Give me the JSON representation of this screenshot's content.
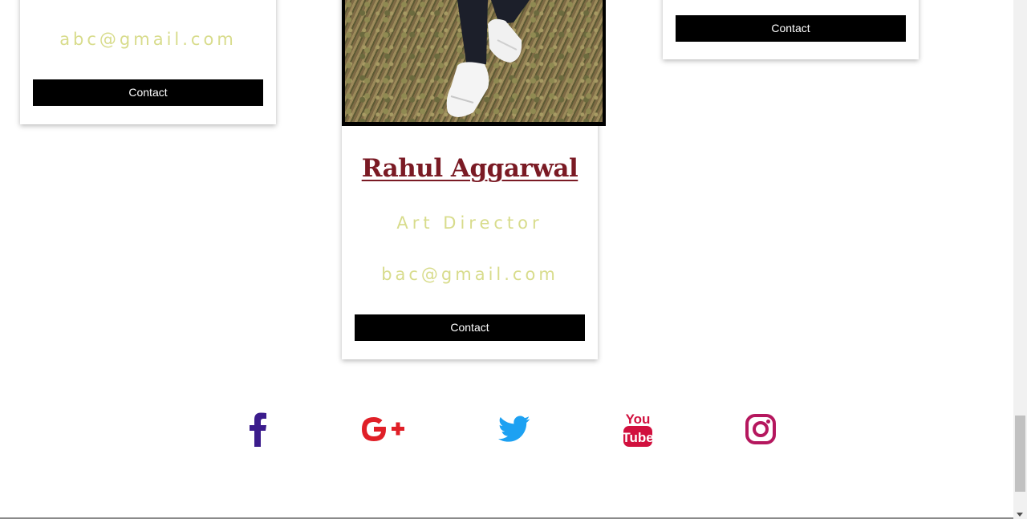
{
  "cards": [
    {
      "email": "abc@gmail.com",
      "contact_label": "Contact"
    },
    {
      "name": "Rahul Aggarwal",
      "role": "Art Director",
      "email": "bac@gmail.com",
      "contact_label": "Contact"
    },
    {
      "contact_label": "Contact"
    }
  ],
  "social": [
    {
      "icon": "facebook-icon",
      "color": "#3b1c8c"
    },
    {
      "icon": "google-plus-icon",
      "color": "#e01f27"
    },
    {
      "icon": "twitter-icon",
      "color": "#1da1f2"
    },
    {
      "icon": "youtube-icon",
      "color": "#d1103e"
    },
    {
      "icon": "instagram-icon",
      "color": "#b5175e"
    }
  ],
  "colors": {
    "accent_text": "#d8dc8c",
    "name_color": "#7a1a24",
    "button_bg": "#000000"
  }
}
